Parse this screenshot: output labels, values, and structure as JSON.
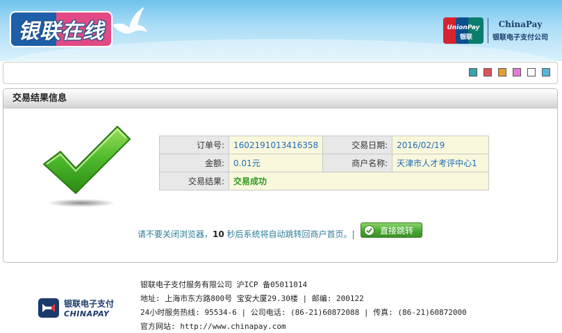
{
  "header": {
    "logo_text": "银联在线",
    "chinapay_en": "ChinaPay",
    "chinapay_cn": "银联电子支付公司",
    "unionpay_en": "UnionPay",
    "unionpay_cn": "银联"
  },
  "toolbar": {
    "swatches": [
      {
        "name": "teal",
        "color": "#3aa3ad"
      },
      {
        "name": "red",
        "color": "#d9575b"
      },
      {
        "name": "orange",
        "color": "#e2a02e"
      },
      {
        "name": "pink",
        "color": "#e47bd3"
      },
      {
        "name": "white",
        "color": "#ffffff"
      },
      {
        "name": "blue",
        "color": "#58b4d8"
      }
    ]
  },
  "panel": {
    "title": "交易结果信息",
    "order_no_label": "订单号:",
    "order_no": "1602191013416358",
    "date_label": "交易日期:",
    "date": "2016/02/19",
    "amount_label": "金额:",
    "amount": "0.01元",
    "merchant_label": "商户名称:",
    "merchant": "天津市人才考评中心1",
    "result_label": "交易结果:",
    "result": "交易成功"
  },
  "redirect": {
    "prefix": "请不要关闭浏览器，",
    "seconds": "10",
    "suffix": " 秒后系统将自动跳转回商户首页。|",
    "button_label": "直接跳转"
  },
  "footer": {
    "logo_cn": "银联电子支付",
    "logo_en": "CHINAPAY",
    "line1": "银联电子支付服务有限公司 沪ICP 备05011014",
    "line2": "地址: 上海市东方路800号 宝安大厦29.30楼 | 邮编: 200122",
    "line3": "24小时服务热线: 95534-6 | 公司电话: (86-21)60872088 | 传真: (86-21)60872000",
    "line4": "官方网站: http://www.chinapay.com"
  },
  "colors": {
    "header_blue": "#6fc3ee",
    "value_blue": "#1e6bb8",
    "success_green": "#2e9a22",
    "button_green": "#4aa834"
  }
}
